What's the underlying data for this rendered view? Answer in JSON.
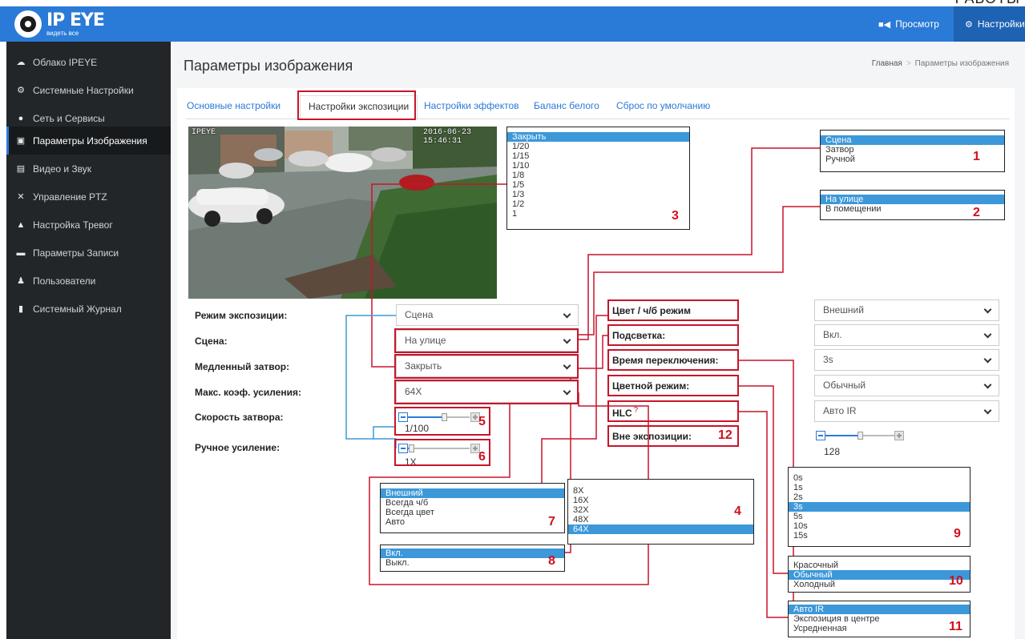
{
  "corner_text": "РАБОТЫ",
  "header": {
    "logo_title": "IP EYE",
    "logo_subtitle": "видеть все",
    "nav_view": "Просмотр",
    "nav_settings": "Настройки",
    "accent_color": "#2a7ad7"
  },
  "sidebar": {
    "items": [
      {
        "label": "Облако IPEYE",
        "icon": "cloud-icon"
      },
      {
        "label": "Системные Настройки",
        "icon": "gears-icon"
      },
      {
        "label": "Сеть и Сервисы",
        "icon": "globe-icon"
      },
      {
        "label": "Параметры Изображения",
        "icon": "picture-icon",
        "active": true
      },
      {
        "label": "Видео и Звук",
        "icon": "file-icon"
      },
      {
        "label": "Управление PTZ",
        "icon": "arrows-icon"
      },
      {
        "label": "Настройка Тревог",
        "icon": "warning-icon"
      },
      {
        "label": "Параметры Записи",
        "icon": "hdd-icon"
      },
      {
        "label": "Пользователи",
        "icon": "users-icon"
      },
      {
        "label": "Системный Журнал",
        "icon": "book-icon"
      }
    ]
  },
  "page": {
    "title": "Параметры изображения",
    "breadcrumb_home": "Главная",
    "breadcrumb_current": "Параметры изображения"
  },
  "tabs": [
    "Основные настройки",
    "Настройки экспозиции",
    "Настройки эффектов",
    "Баланс белого",
    "Сброс по умолчанию"
  ],
  "camera": {
    "osd_left": "IPEYE",
    "osd_timestamp": "2016-06-23 15:46:31"
  },
  "left_form": {
    "exposure_mode_label": "Режим экспозиции:",
    "exposure_mode_value": "Сцена",
    "scene_label": "Сцена:",
    "scene_value": "На улице",
    "slow_shutter_label": "Медленный затвор:",
    "slow_shutter_value": "Закрыть",
    "max_gain_label": "Макс. коэф. усиления:",
    "max_gain_value": "64X",
    "shutter_speed_label": "Скорость затвора:",
    "shutter_speed_value": "1/100",
    "shutter_speed_level": 0.6,
    "manual_gain_label": "Ручное усиление:",
    "manual_gain_value": "1X",
    "manual_gain_level": 0.02
  },
  "right_form": {
    "color_bw_label": "Цвет / ч/б режим",
    "color_bw_value": "Внешний",
    "backlight_label": "Подсветка:",
    "backlight_value": "Вкл.",
    "switch_time_label": "Время переключения:",
    "switch_time_value": "3s",
    "color_mode_label": "Цветной режим:",
    "color_mode_value": "Обычный",
    "hlc_label": "HLC",
    "hlc_help": "?",
    "hlc_value": "Авто IR",
    "out_exposure_label": "Вне экспозиции:",
    "out_exposure_value": "128",
    "out_exposure_level": 0.5
  },
  "annotations": {
    "d1": {
      "num": "1",
      "items": [
        "Сцена",
        "Затвор",
        "Ручной"
      ],
      "selected": 0
    },
    "d2": {
      "num": "2",
      "items": [
        "На улице",
        "В помещении"
      ],
      "selected": 0
    },
    "d3": {
      "num": "3",
      "items": [
        "Закрыть",
        "1/20",
        "1/15",
        "1/10",
        "1/8",
        "1/5",
        "1/3",
        "1/2",
        "1"
      ],
      "selected": 0
    },
    "d4": {
      "num": "4",
      "items": [
        "8X",
        "16X",
        "32X",
        "48X",
        "64X"
      ],
      "selected": 4
    },
    "n5": "5",
    "n6": "6",
    "d7": {
      "num": "7",
      "items": [
        "Внешний",
        "Всегда ч/б",
        "Всегда цвет",
        "Авто"
      ],
      "selected": 0
    },
    "d8": {
      "num": "8",
      "items": [
        "Вкл.",
        "Выкл."
      ],
      "selected": 0
    },
    "d9": {
      "num": "9",
      "items": [
        "0s",
        "1s",
        "2s",
        "3s",
        "5s",
        "10s",
        "15s"
      ],
      "selected": 3
    },
    "d10": {
      "num": "10",
      "items": [
        "Красочный",
        "Обычный",
        "Холодный"
      ],
      "selected": 1
    },
    "d11": {
      "num": "11",
      "items": [
        "Авто IR",
        "Экспозиция в центре",
        "Усредненная"
      ],
      "selected": 0
    },
    "n12": "12",
    "annotation_color": "#c8142a"
  }
}
